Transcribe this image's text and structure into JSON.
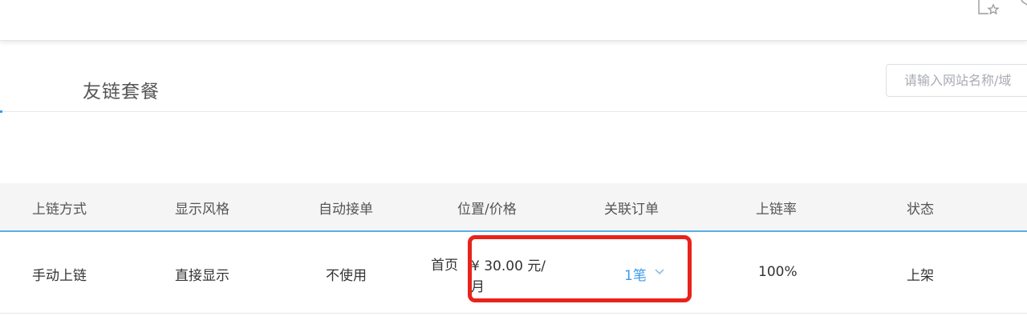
{
  "page": {
    "title": "友链套餐",
    "search_placeholder": "请输入网站名称/域"
  },
  "table": {
    "headers": [
      "上链方式",
      "显示风格",
      "自动接单",
      "位置/价格",
      "关联订单",
      "上链率",
      "状态"
    ],
    "rows": [
      {
        "method": "手动上链",
        "style": "直接显示",
        "auto_accept": "不使用",
        "position": "首页",
        "price": "¥ 30.00 元/月",
        "orders": "1笔",
        "rate": "100%",
        "status": "上架"
      }
    ]
  },
  "colors": {
    "accent": "#3d9be9",
    "highlight": "#e8231b",
    "header_bg": "#f5f5f5"
  },
  "icons": {
    "topbar": [
      "favorite-page-icon",
      "extension-icon"
    ],
    "order_toggle": "chevron-down-icon"
  }
}
